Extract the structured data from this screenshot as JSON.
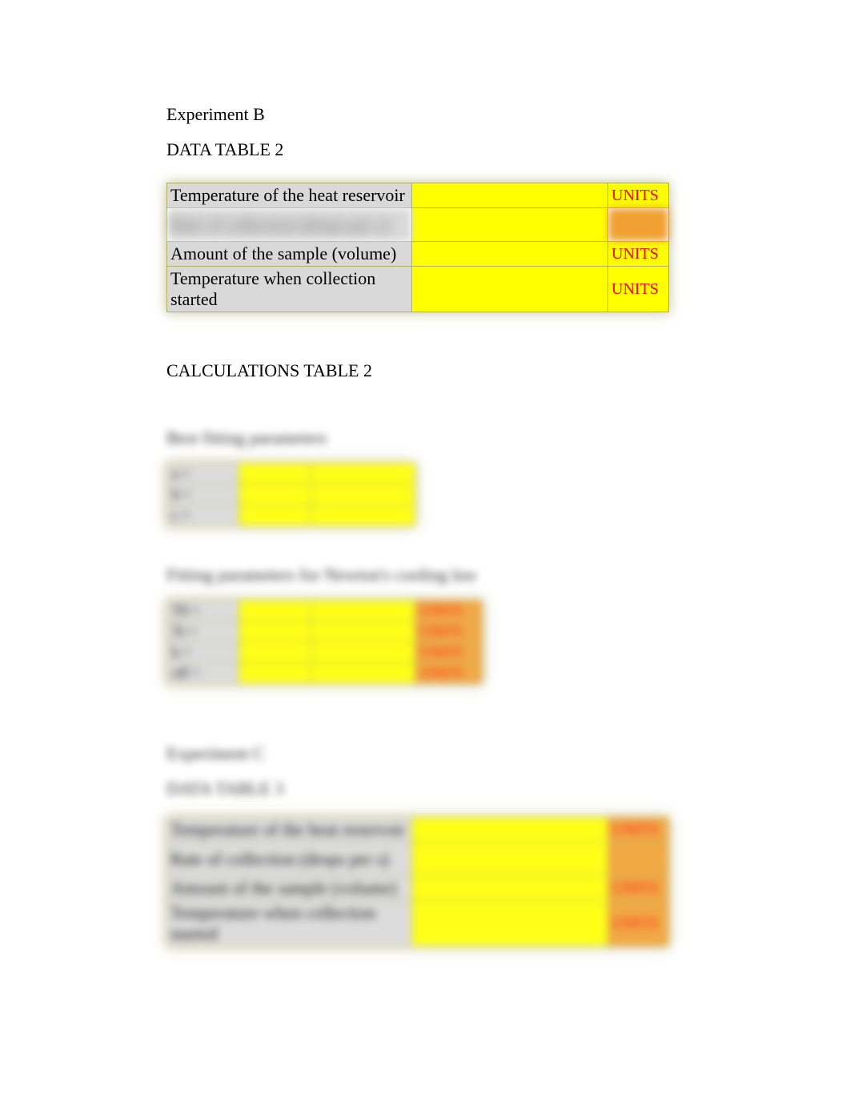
{
  "experimentB": {
    "title": "Experiment B",
    "tableTitle": "DATA TABLE 2",
    "rows": [
      {
        "label": "Temperature of the heat reservoir",
        "value": "",
        "units": "UNITS",
        "unitsClass": ""
      },
      {
        "label": "Rate of collection (drops per s)",
        "value": "",
        "units": "",
        "unitsClass": "orange",
        "blur": true,
        "tall": true
      },
      {
        "label": "Amount of the sample (volume)",
        "value": "",
        "units": "UNITS",
        "unitsClass": ""
      },
      {
        "label": "Temperature when collection started",
        "value": "",
        "units": "UNITS",
        "unitsClass": ""
      }
    ],
    "calcTitle": "CALCULATIONS TABLE 2",
    "calcSub1": "Best fitting parameters",
    "fitTable1": [
      {
        "label": "a =",
        "v1": "",
        "v2": ""
      },
      {
        "label": "b =",
        "v1": "",
        "v2": ""
      },
      {
        "label": "c =",
        "v1": "",
        "v2": ""
      }
    ],
    "calcSub2": "Fitting parameters for Newton's cooling law",
    "fitTable2": [
      {
        "label": "T0 =",
        "v1": "",
        "v2": "",
        "units": "UNITS"
      },
      {
        "label": "Ts =",
        "v1": "",
        "v2": "",
        "units": "UNITS"
      },
      {
        "label": "k =",
        "v1": "",
        "v2": "",
        "units": "UNITS"
      },
      {
        "label": "off =",
        "v1": "",
        "v2": "",
        "units": "UNITS"
      }
    ]
  },
  "experimentC": {
    "title": "Experiment C",
    "tableTitle": "DATA TABLE 3",
    "rows": [
      {
        "label": "Temperature of the heat reservoir",
        "value": "",
        "units": "UNITS",
        "unitsClass": "orange",
        "blur": true
      },
      {
        "label": "Rate of collection (drops per s)",
        "value": "",
        "units": "",
        "unitsClass": "orange",
        "blur": true,
        "tall": true
      },
      {
        "label": "Amount of the sample (volume)",
        "value": "",
        "units": "UNITS",
        "unitsClass": "orange",
        "blur": true
      },
      {
        "label": "Temperature when collection started",
        "value": "",
        "units": "UNITS",
        "unitsClass": "orange",
        "blur": true
      }
    ]
  }
}
